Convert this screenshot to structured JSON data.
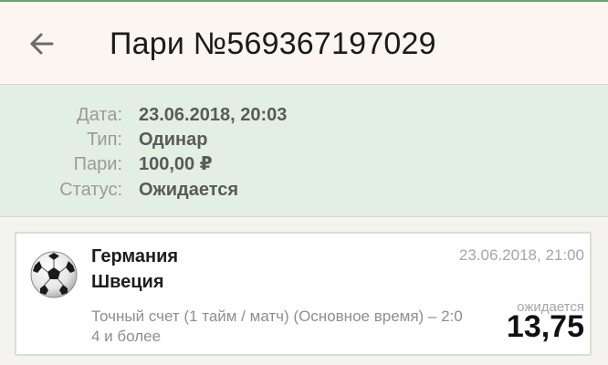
{
  "header": {
    "title": "Пари №569367197029"
  },
  "details": {
    "rows": [
      {
        "label": "Дата:",
        "value": "23.06.2018, 20:03"
      },
      {
        "label": "Тип:",
        "value": "Одинар"
      },
      {
        "label": "Пари:",
        "value": "100,00 ₽"
      },
      {
        "label": "Статус:",
        "value": "Ожидается"
      }
    ]
  },
  "event": {
    "team1": "Германия",
    "team2": "Швеция",
    "datetime": "23.06.2018, 21:00",
    "market": "Точный счет (1 тайм / матч) (Основное время) – 2:0 4 и более",
    "status": "ожидается",
    "odds": "13,75"
  },
  "icons": {
    "back": "arrow-back-icon",
    "sport": "soccer-ball-icon"
  },
  "colors": {
    "accent_green": "#6aa36d",
    "details_bg": "#e3efe3",
    "card_border": "#cfe3cf"
  }
}
